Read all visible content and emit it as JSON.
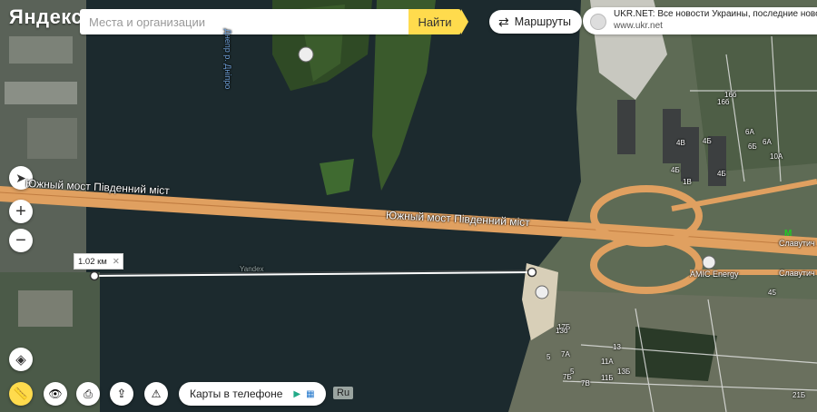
{
  "logo": "Яндекс",
  "search": {
    "placeholder": "Места и организации",
    "button": "Найти"
  },
  "routes_button": "Маршруты",
  "ad": {
    "title": "UKR.NET: Все новости Украины, последние новости дня",
    "url": "www.ukr.net"
  },
  "ruler": {
    "distance": "1.02 км"
  },
  "bridge_labels": [
    "Южный мост Південний міст",
    "Южный мост Південний міст"
  ],
  "river_label": "Днепр р. Дніпро",
  "station_labels": [
    "Славутич",
    "Славутич"
  ],
  "poi_label": "AMIC Energy",
  "watermark": "Yandex",
  "phone_promo": "Карты в телефоне",
  "lang": "Ru",
  "house_numbers": [
    "16б",
    "4В",
    "4Б",
    "6А",
    "6Б",
    "4Б",
    "1В",
    "16б",
    "4Б",
    "6А",
    "10А",
    "17Б",
    "13",
    "13б",
    "5",
    "7А",
    "5",
    "7Б",
    "7В",
    "11А",
    "11Б",
    "13Б",
    "45",
    "21Б"
  ],
  "colors": {
    "road": "#e0a060",
    "water": "#1f2a30",
    "accent": "#ffdb4d"
  },
  "icons": [
    "locate-icon",
    "zoom-in-icon",
    "zoom-out-icon",
    "layers-icon",
    "ruler-icon",
    "panorama-icon",
    "print-icon",
    "share-icon",
    "alert-icon",
    "apple-icon",
    "play-store-icon",
    "windows-icon",
    "metro-icon",
    "close-icon",
    "routes-icon"
  ]
}
